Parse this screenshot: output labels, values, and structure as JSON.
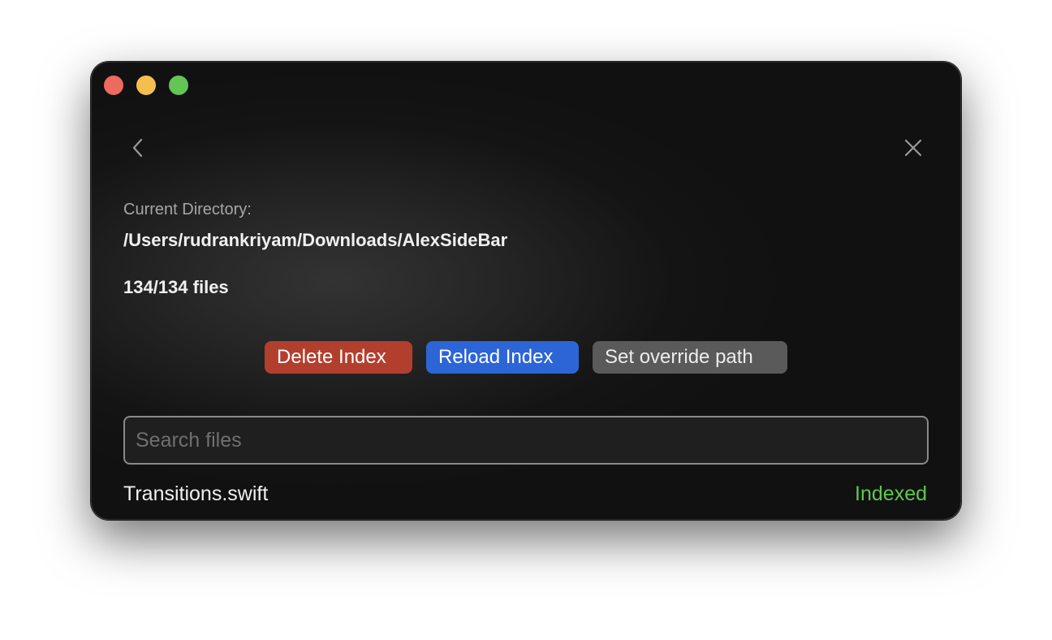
{
  "window": {
    "traffic_lights": [
      "close",
      "minimize",
      "zoom"
    ]
  },
  "nav": {
    "back_icon": "chevron-left-icon",
    "close_icon": "close-icon"
  },
  "directory": {
    "label": "Current Directory:",
    "path": "/Users/rudrankriyam/Downloads/AlexSideBar"
  },
  "file_count": "134/134 files",
  "actions": {
    "delete_label": "Delete Index",
    "reload_label": "Reload Index",
    "override_label": "Set override path"
  },
  "search": {
    "placeholder": "Search files",
    "value": ""
  },
  "files": [
    {
      "name": "Transitions.swift",
      "status": "Indexed"
    }
  ],
  "colors": {
    "delete": "#b23f2e",
    "reload": "#2d65d6",
    "override": "#5a5a5a",
    "indexed": "#5fc751"
  }
}
